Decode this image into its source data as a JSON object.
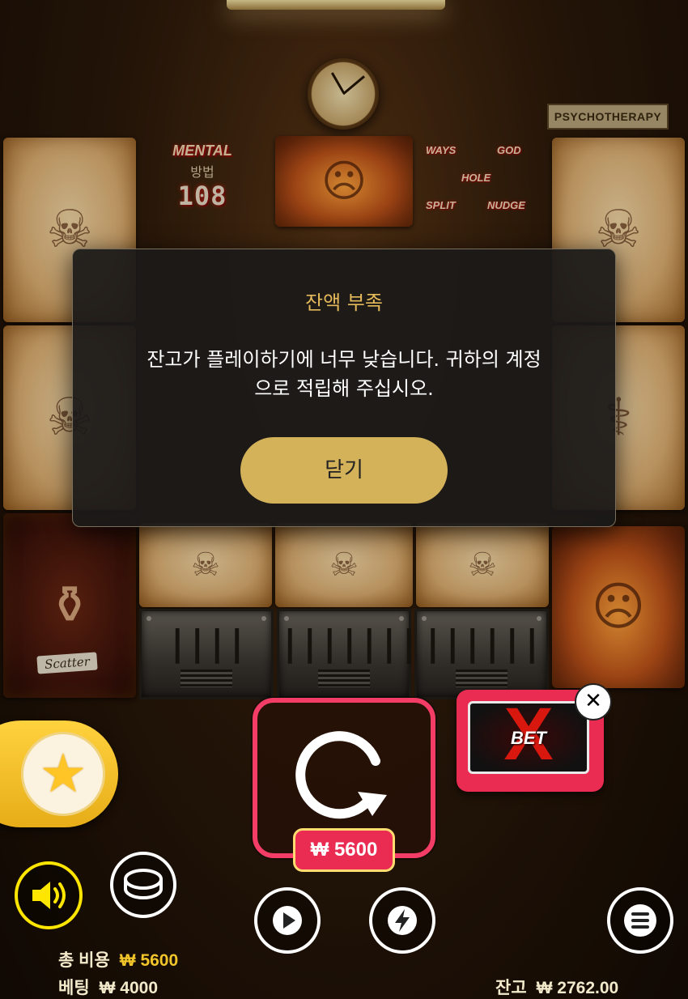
{
  "background": {
    "sign_text": "PSYCHOTHERAPY"
  },
  "reel_panels": {
    "mental_logo": "MENTAL",
    "mental_subtitle": "방법",
    "mental_ways": "108",
    "features": [
      "WAYS",
      "GOD",
      "HOLE",
      "SPLIT",
      "NUDGE"
    ],
    "scatter_label": "Scatter",
    "tally_marks": [
      "||||",
      "|||||||",
      "||||||"
    ]
  },
  "modal": {
    "title": "잔액 부족",
    "message_line1": "잔고가 플레이하기에 너무 낮습니다. 귀하의 계정",
    "message_line2": "으로 적립해 주십시오.",
    "close_label": "닫기"
  },
  "controls": {
    "spin_cost": "₩ 5600",
    "betx_text": "BET",
    "betx_x": "X",
    "close_icon": "✕"
  },
  "footer": {
    "total_cost_label": "총 비용",
    "total_cost_value": "₩ 5600",
    "bet_label": "베팅",
    "bet_value": "₩ 4000",
    "balance_label": "잔고",
    "balance_value": "₩ 2762.00"
  },
  "colors": {
    "accent_gold": "#d4b25a",
    "title_gold": "#e4b95a",
    "spin_pink": "#f33d67",
    "sound_yellow": "#ffe600",
    "value_yellow": "#f2c52a"
  },
  "icons": [
    "star-icon",
    "spin-arrow-icon",
    "speaker-icon",
    "coin-icon",
    "play-icon",
    "lightning-icon",
    "menu-icon",
    "close-icon"
  ]
}
